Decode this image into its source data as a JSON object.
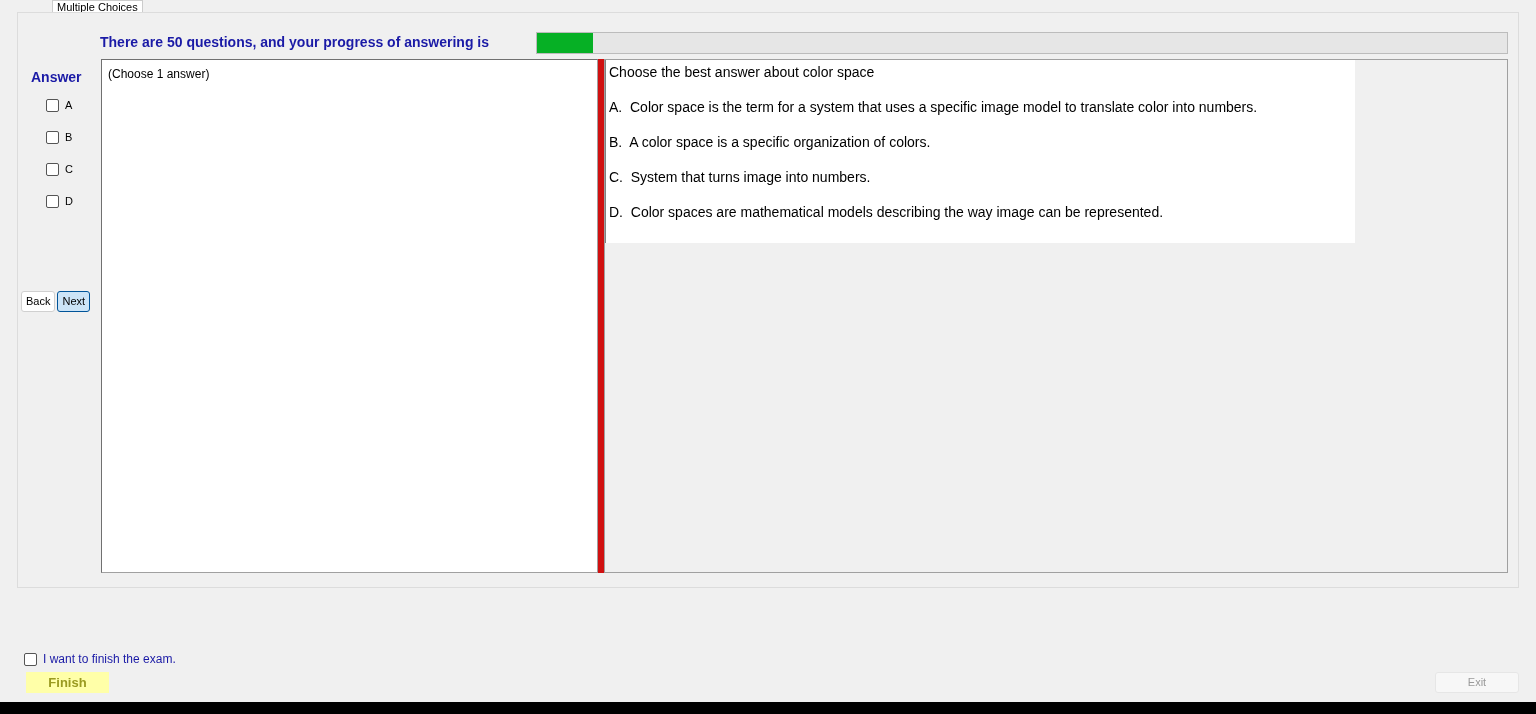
{
  "tab": {
    "label": "Multiple Choices",
    "selected": true
  },
  "header": {
    "text": "There are 50 questions, and your progress of answering is",
    "progress": {
      "level": 0.058
    }
  },
  "answer_panel": {
    "label": "Answer",
    "options": [
      {
        "label": "A",
        "checked": false
      },
      {
        "label": "B",
        "checked": false
      },
      {
        "label": "C",
        "checked": false
      },
      {
        "label": "D",
        "checked": false
      }
    ]
  },
  "nav_buttons": [
    {
      "label": "Back",
      "selected": false
    },
    {
      "label": "Next",
      "selected": true
    }
  ],
  "answer_box": {
    "text": "(Choose 1 answer)"
  },
  "question": {
    "text": "Choose the best answer about color space",
    "choices": [
      "A.  Color space is the term for a system that uses a specific image model to translate color into numbers.",
      "B.  A color space is a specific organization of colors.",
      "C.  System that turns image into numbers.",
      "D.  Color spaces are mathematical models describing the way image can be represented."
    ]
  },
  "finish_confirm": {
    "label": "I want to finish the exam.",
    "checked": false
  },
  "finish_button": {
    "label": "Finish"
  },
  "exit_button": {
    "label": "Exit",
    "disabled": true
  }
}
